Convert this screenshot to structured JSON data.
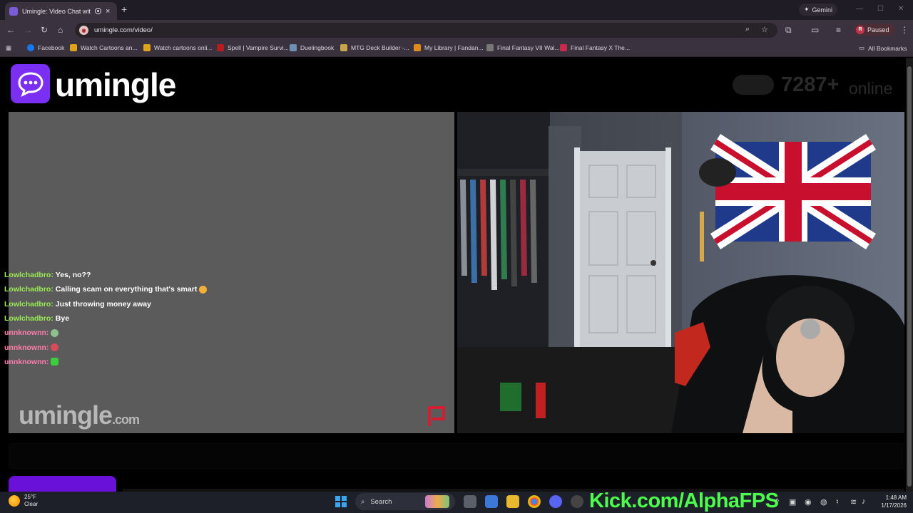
{
  "browser": {
    "tab_title": "Umingle: Video Chat with S",
    "new_tab_symbol": "+",
    "gemini_label": "Gemini",
    "url": "umingle.com/video/",
    "profile_initial": "R",
    "profile_status": "Paused",
    "bookmarks": [
      {
        "label": "Facebook",
        "color": "#1877f2"
      },
      {
        "label": "Watch Cartoons an...",
        "color": "#e0a21a"
      },
      {
        "label": "Watch cartoons onli...",
        "color": "#e0a21a"
      },
      {
        "label": "Spell | Vampire Survi...",
        "color": "#b81d1d"
      },
      {
        "label": "Duelingbook",
        "color": "#6f8fb5"
      },
      {
        "label": "MTG Deck Builder -...",
        "color": "#c9a44a"
      },
      {
        "label": "My Library | Fandan...",
        "color": "#e08a1e"
      },
      {
        "label": "Final Fantasy VII Wal...",
        "color": "#777777"
      },
      {
        "label": "Final Fantasy X The...",
        "color": "#c9294a"
      }
    ],
    "all_bookmarks": "All Bookmarks"
  },
  "site": {
    "logo_text": "umingle",
    "online_count": "7287+",
    "online_label": "online",
    "watermark_main": "umingle",
    "watermark_suffix": ".com",
    "brand_color": "#7b2ff2"
  },
  "chat": [
    {
      "user": "Lowlchadbro:",
      "text": "Yes, no??",
      "user_type": "stranger",
      "emoji": ""
    },
    {
      "user": "Lowlchadbro:",
      "text": "Calling scam on everything that's smart",
      "user_type": "stranger",
      "emoji": "#f2b03a"
    },
    {
      "user": "Lowlchadbro:",
      "text": "Just throwing money away",
      "user_type": "stranger",
      "emoji": ""
    },
    {
      "user": "Lowlchadbro:",
      "text": "Bye",
      "user_type": "stranger",
      "emoji": ""
    },
    {
      "user": "unnknownn:",
      "text": "",
      "user_type": "you",
      "emoji": "#8fbf8f"
    },
    {
      "user": "unnknownn:",
      "text": "",
      "user_type": "you",
      "emoji": "#d94a5a"
    },
    {
      "user": "unnknownn:",
      "text": "",
      "user_type": "you",
      "emoji": "#3ccf3c"
    }
  ],
  "taskbar": {
    "temperature": "25°F",
    "weather": "Clear",
    "search_label": "Search",
    "kick_text": "Kick.com/AlphaFPS",
    "time": "1:48 AM",
    "date": "1/17/2026"
  }
}
